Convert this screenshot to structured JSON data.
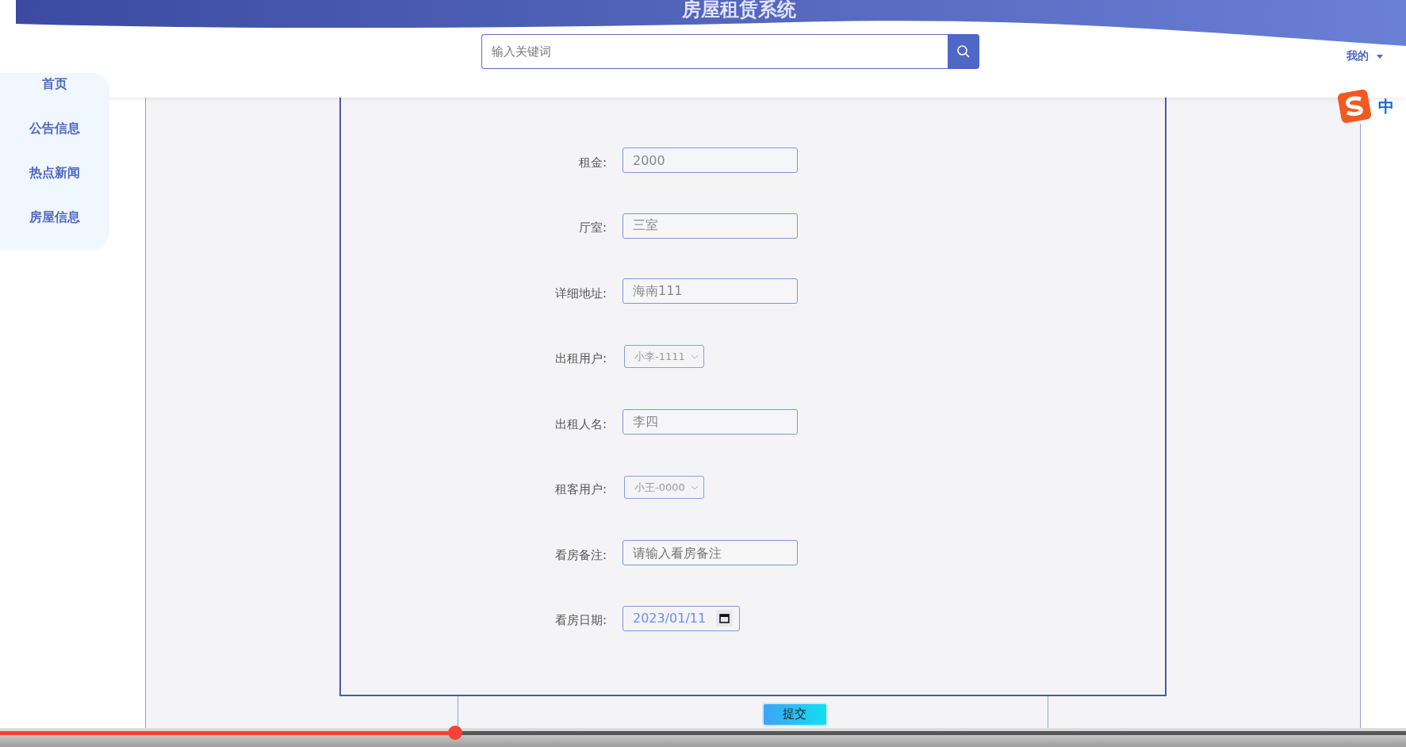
{
  "header": {
    "title": "房屋租赁系统",
    "search": {
      "placeholder": "输入关键词"
    },
    "user_menu": "我的"
  },
  "sidebar": {
    "items": [
      {
        "label": "首页"
      },
      {
        "label": "公告信息"
      },
      {
        "label": "热点新闻"
      },
      {
        "label": "房屋信息"
      }
    ]
  },
  "ime": {
    "mode": "中"
  },
  "form": {
    "fields": [
      {
        "kind": "input",
        "label": "租金:",
        "value": "2000"
      },
      {
        "kind": "input",
        "label": "厅室:",
        "value": "三室"
      },
      {
        "kind": "input",
        "label": "详细地址:",
        "value": "海南111"
      },
      {
        "kind": "select",
        "label": "出租用户:",
        "value": "小李-1111"
      },
      {
        "kind": "input",
        "label": "出租人名:",
        "value": "李四"
      },
      {
        "kind": "select",
        "label": "租客用户:",
        "value": "小王-0000"
      },
      {
        "kind": "input",
        "label": "看房备注:",
        "placeholder": "请输入看房备注"
      },
      {
        "kind": "date",
        "label": "看房日期:",
        "value": "2023/01/11"
      }
    ],
    "submit": "提交"
  },
  "video_player": {
    "level": 0.324
  }
}
